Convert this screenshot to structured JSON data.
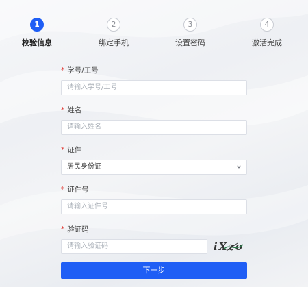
{
  "steps": [
    {
      "number": "1",
      "label": "校验信息",
      "active": true
    },
    {
      "number": "2",
      "label": "绑定手机",
      "active": false
    },
    {
      "number": "3",
      "label": "设置密码",
      "active": false
    },
    {
      "number": "4",
      "label": "激活完成",
      "active": false
    }
  ],
  "form": {
    "required_mark": "*",
    "student_id": {
      "label": "学号/工号",
      "placeholder": "请输入学号/工号"
    },
    "name": {
      "label": "姓名",
      "placeholder": "请输入姓名"
    },
    "id_type": {
      "label": "证件",
      "value": "居民身份证"
    },
    "id_number": {
      "label": "证件号",
      "placeholder": "请输入证件号"
    },
    "captcha": {
      "label": "验证码",
      "placeholder": "请输入验证码",
      "image_text": "iXzo"
    }
  },
  "submit_label": "下一步",
  "colors": {
    "primary": "#1f5ef5",
    "required": "#e2413b"
  }
}
